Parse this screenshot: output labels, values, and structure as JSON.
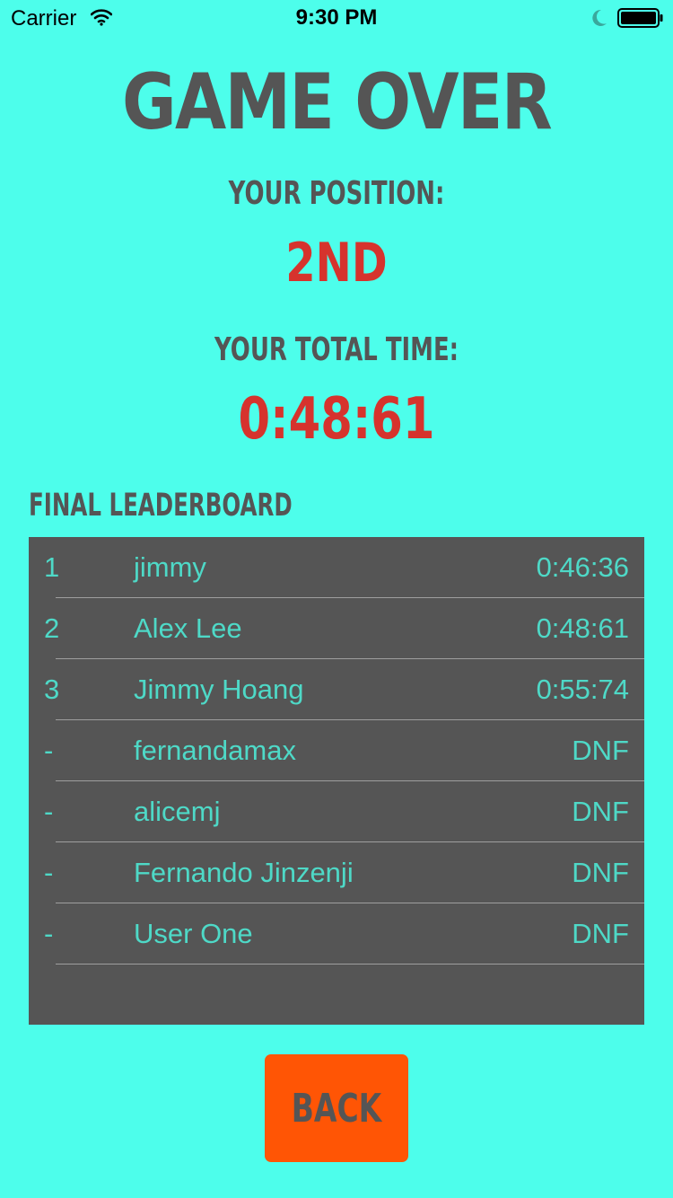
{
  "status_bar": {
    "carrier": "Carrier",
    "time": "9:30 PM",
    "icons": [
      "wifi-icon",
      "moon-icon",
      "battery-icon"
    ]
  },
  "title": "Game Over",
  "position_label": "Your Position:",
  "position_value": "2nd",
  "total_time_label": "Your Total Time:",
  "total_time_value": "0:48:61",
  "leaderboard": {
    "title": "Final Leaderboard",
    "rows": [
      {
        "rank": "1",
        "name": "jimmy",
        "time": "0:46:36"
      },
      {
        "rank": "2",
        "name": "Alex Lee",
        "time": "0:48:61"
      },
      {
        "rank": "3",
        "name": "Jimmy Hoang",
        "time": "0:55:74"
      },
      {
        "rank": "-",
        "name": "fernandamax",
        "time": "DNF"
      },
      {
        "rank": "-",
        "name": "alicemj",
        "time": "DNF"
      },
      {
        "rank": "-",
        "name": "Fernando Jinzenji",
        "time": "DNF"
      },
      {
        "rank": "-",
        "name": "User One",
        "time": "DNF"
      }
    ]
  },
  "back_button": "Back",
  "colors": {
    "background": "#4dfeeb",
    "text_dark": "#555555",
    "highlight_red": "#d6332d",
    "table_background": "#555555",
    "table_text": "#4ed9c7",
    "button": "#ff5505"
  }
}
